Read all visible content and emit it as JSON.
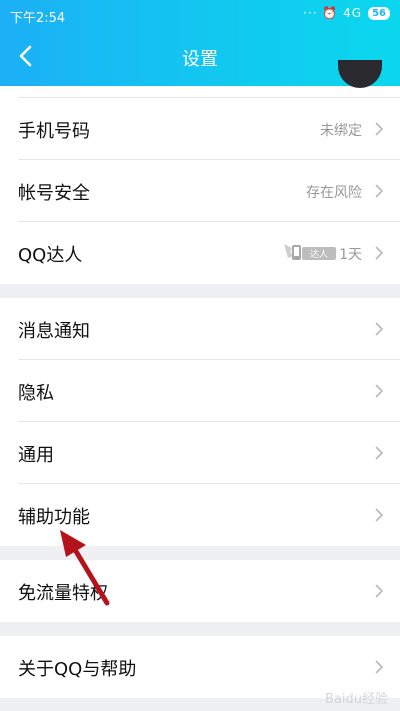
{
  "status_bar": {
    "time": "下午2:54",
    "indicators": "··· ⏰ 4G",
    "battery": "56"
  },
  "navbar": {
    "title": "设置"
  },
  "rows": [
    {
      "label": "手机号码",
      "value": "未绑定"
    },
    {
      "label": "帐号安全",
      "value": "存在风险"
    },
    {
      "label": "QQ达人",
      "value": "1天",
      "badge_text": "达人"
    },
    {
      "label": "消息通知",
      "value": ""
    },
    {
      "label": "隐私",
      "value": ""
    },
    {
      "label": "通用",
      "value": ""
    },
    {
      "label": "辅助功能",
      "value": ""
    },
    {
      "label": "免流量特权",
      "value": ""
    },
    {
      "label": "关于QQ与帮助",
      "value": ""
    }
  ],
  "watermark": "Baidu经验",
  "colors": {
    "header_start": "#1cb0f6",
    "header_end": "#0ad7ee",
    "annotation_arrow": "#b5131a"
  }
}
